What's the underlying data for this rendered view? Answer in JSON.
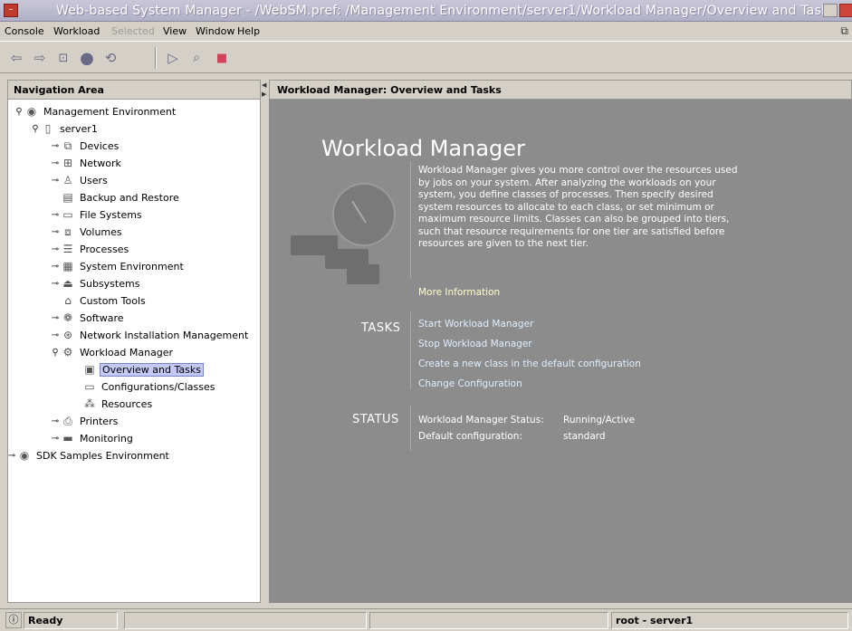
{
  "window": {
    "title": "Web-based System Manager - /WebSM.pref: /Management Environment/server1/Workload Manager/Overview and Tasks"
  },
  "menubar": {
    "items": [
      {
        "label": "Console"
      },
      {
        "label": "Workload"
      },
      {
        "label": "Selected"
      },
      {
        "label": "View"
      },
      {
        "label": "Window"
      },
      {
        "label": "Help"
      }
    ]
  },
  "toolbar": {
    "buttons": [
      {
        "icon": "back-icon"
      },
      {
        "icon": "forward-icon"
      },
      {
        "icon": "up-level-icon"
      },
      {
        "icon": "stop-loading-icon"
      },
      {
        "icon": "reload-icon"
      },
      {
        "icon": "run-icon"
      },
      {
        "icon": "find-icon"
      },
      {
        "icon": "stop-icon"
      }
    ]
  },
  "navigation": {
    "header": "Navigation Area",
    "tree": [
      {
        "label": "Management Environment",
        "icon": "management-environment-icon",
        "toggle": "expanded"
      },
      {
        "label": "server1",
        "icon": "server-icon",
        "toggle": "expanded"
      },
      {
        "label": "Devices",
        "icon": "devices-icon",
        "toggle": "collapsed"
      },
      {
        "label": "Network",
        "icon": "network-icon",
        "toggle": "collapsed"
      },
      {
        "label": "Users",
        "icon": "users-icon",
        "toggle": "collapsed"
      },
      {
        "label": "Backup and Restore",
        "icon": "backup-icon",
        "toggle": "none"
      },
      {
        "label": "File Systems",
        "icon": "file-systems-icon",
        "toggle": "collapsed"
      },
      {
        "label": "Volumes",
        "icon": "volumes-icon",
        "toggle": "collapsed"
      },
      {
        "label": "Processes",
        "icon": "processes-icon",
        "toggle": "collapsed"
      },
      {
        "label": "System Environment",
        "icon": "system-environment-icon",
        "toggle": "collapsed"
      },
      {
        "label": "Subsystems",
        "icon": "subsystems-icon",
        "toggle": "collapsed"
      },
      {
        "label": "Custom Tools",
        "icon": "custom-tools-icon",
        "toggle": "none"
      },
      {
        "label": "Software",
        "icon": "software-icon",
        "toggle": "collapsed"
      },
      {
        "label": "Network Installation Management",
        "icon": "network-installation-icon",
        "toggle": "collapsed"
      },
      {
        "label": "Workload Manager",
        "icon": "workload-manager-icon",
        "toggle": "expanded"
      },
      {
        "label": "Overview and Tasks",
        "icon": "overview-icon",
        "toggle": "none",
        "selected": true
      },
      {
        "label": "Configurations/Classes",
        "icon": "configurations-icon",
        "toggle": "none"
      },
      {
        "label": "Resources",
        "icon": "resources-icon",
        "toggle": "none"
      },
      {
        "label": "Printers",
        "icon": "printers-icon",
        "toggle": "collapsed"
      },
      {
        "label": "Monitoring",
        "icon": "monitoring-icon",
        "toggle": "collapsed"
      },
      {
        "label": "SDK Samples Environment",
        "icon": "sdk-environment-icon",
        "toggle": "collapsed"
      }
    ]
  },
  "content": {
    "header": "Workload Manager: Overview and Tasks",
    "title": "Workload Manager",
    "description": "Workload Manager gives you more control over the resources used by jobs on your system. After analyzing the workloads on your system, you define classes of processes. Then specify desired system resources to allocate to each class, or set minimum or maximum resource limits. Classes can also be grouped into tiers, such that resource requirements for one tier are satisfied before resources are given to the next tier.",
    "more_info": "More Information",
    "tasks_label": "TASKS",
    "tasks": [
      "Start Workload Manager",
      "Stop Workload Manager",
      "Create a new class in the default configuration",
      "Change Configuration"
    ],
    "status_label": "STATUS",
    "status": [
      {
        "key": "Workload Manager Status:",
        "value": "Running/Active"
      },
      {
        "key": "Default configuration:",
        "value": "standard"
      }
    ]
  },
  "statusbar": {
    "state": "Ready",
    "user": "root - server1"
  },
  "colors": {
    "content_bg": "#8c8c8c",
    "selection": "#c4c8f4",
    "link": "#ffffcc"
  }
}
